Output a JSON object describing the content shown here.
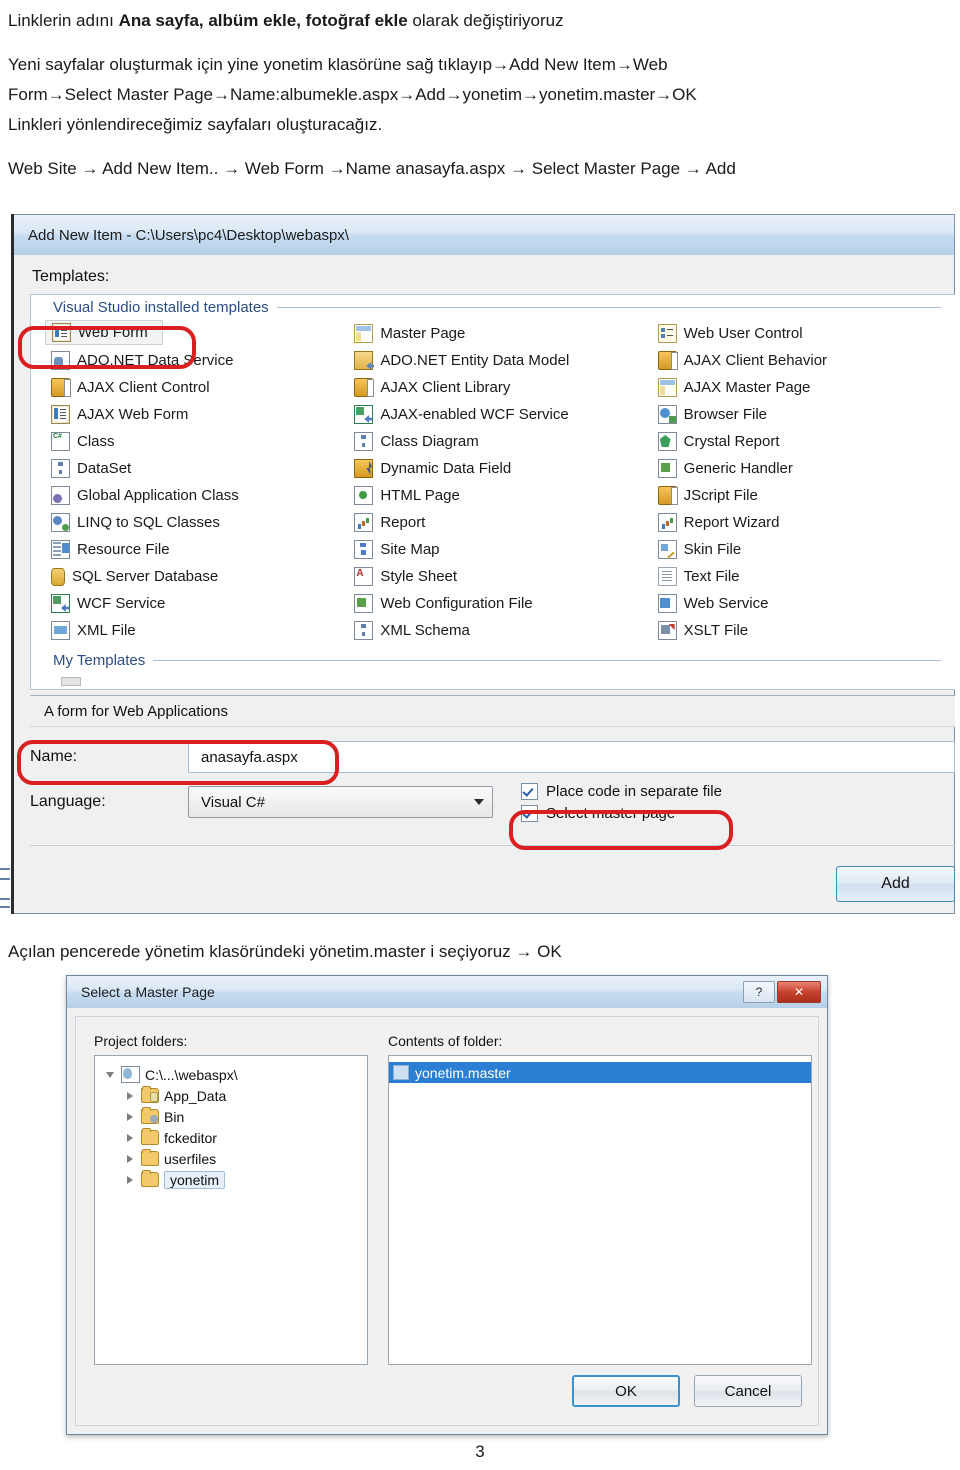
{
  "document": {
    "lines": [
      {
        "id": "l1",
        "segments": [
          {
            "t": "Linklerin adını ",
            "b": false
          },
          {
            "t": "Ana sayfa, albüm ekle, fotoğraf ekle",
            "b": true
          },
          {
            "t": " olarak değiştiriyoruz",
            "b": false
          }
        ]
      },
      {
        "id": "gap1",
        "gap": true
      },
      {
        "id": "l2",
        "segments": [
          {
            "t": "Yeni sayfalar oluşturmak için yine yonetim klasörüne sağ tıklayıp→Add New Item→Web",
            "b": false
          }
        ]
      },
      {
        "id": "l3",
        "segments": [
          {
            "t": "Form→Select Master Page→Name:albumekle.aspx→Add→yonetim→yonetim.master→OK",
            "b": false
          }
        ]
      },
      {
        "id": "l4",
        "segments": [
          {
            "t": "Linkleri yönlendireceğimiz sayfaları oluşturacağız.",
            "b": false
          }
        ]
      },
      {
        "id": "gap2",
        "gap": true
      },
      {
        "id": "l5",
        "segments": [
          {
            "t": "Web Site → Add New Item.. → Web Form →Name  anasayfa.aspx →  Select Master Page → Add",
            "b": false
          }
        ]
      }
    ],
    "middle_caption": "Açılan pencerede yönetim klasöründeki yönetim.master i seçiyoruz → OK",
    "page_number": "3"
  },
  "add_new_item_dialog": {
    "title": "Add New Item - C:\\Users\\pc4\\Desktop\\webaspx\\",
    "templates_label": "Templates:",
    "group_installed": "Visual Studio installed templates",
    "group_my_templates": "My Templates",
    "columns": [
      [
        {
          "label": "Web Form",
          "icon": "form",
          "selected": true
        },
        {
          "label": "ADO.NET Data Service",
          "icon": "ado"
        },
        {
          "label": "AJAX Client Control",
          "icon": "js"
        },
        {
          "label": "AJAX Web Form",
          "icon": "form"
        },
        {
          "label": "Class",
          "icon": "cs"
        },
        {
          "label": "DataSet",
          "icon": "diag"
        },
        {
          "label": "Global Application Class",
          "icon": "gear"
        },
        {
          "label": "LINQ to SQL Classes",
          "icon": "linq"
        },
        {
          "label": "Resource File",
          "icon": "res"
        },
        {
          "label": "SQL Server Database",
          "icon": "db"
        },
        {
          "label": "WCF Service",
          "icon": "wcf"
        },
        {
          "label": "XML File",
          "icon": "xml"
        }
      ],
      [
        {
          "label": "Master Page",
          "icon": "master"
        },
        {
          "label": "ADO.NET Entity Data Model",
          "icon": "adoent"
        },
        {
          "label": "AJAX Client Library",
          "icon": "js"
        },
        {
          "label": "AJAX-enabled WCF Service",
          "icon": "wcf"
        },
        {
          "label": "Class Diagram",
          "icon": "diag"
        },
        {
          "label": "Dynamic Data Field",
          "icon": "dyn"
        },
        {
          "label": "HTML Page",
          "icon": "html"
        },
        {
          "label": "Report",
          "icon": "report"
        },
        {
          "label": "Site Map",
          "icon": "sitemap"
        },
        {
          "label": "Style Sheet",
          "icon": "sheet"
        },
        {
          "label": "Web Configuration File",
          "icon": "handler"
        },
        {
          "label": "XML Schema",
          "icon": "diag"
        }
      ],
      [
        {
          "label": "Web User Control",
          "icon": "wuc"
        },
        {
          "label": "AJAX Client Behavior",
          "icon": "js"
        },
        {
          "label": "AJAX Master Page",
          "icon": "master"
        },
        {
          "label": "Browser File",
          "icon": "browser"
        },
        {
          "label": "Crystal Report",
          "icon": "crystal"
        },
        {
          "label": "Generic Handler",
          "icon": "handler"
        },
        {
          "label": "JScript File",
          "icon": "js"
        },
        {
          "label": "Report Wizard",
          "icon": "report"
        },
        {
          "label": "Skin File",
          "icon": "skin"
        },
        {
          "label": "Text File",
          "icon": "txt"
        },
        {
          "label": "Web Service",
          "icon": "websvc"
        },
        {
          "label": "XSLT File",
          "icon": "xslt"
        }
      ]
    ],
    "description": "A form for Web Applications",
    "name_label": "Name:",
    "name_value": "anasayfa.aspx",
    "language_label": "Language:",
    "language_value": "Visual C#",
    "checkbox_place_code": "Place code in separate file",
    "checkbox_select_master": "Select master page",
    "add_button": "Add"
  },
  "select_master_page_dialog": {
    "title": "Select a Master Page",
    "help_button": "?",
    "close_button": "✕",
    "project_folders_label": "Project folders:",
    "contents_label": "Contents of folder:",
    "tree": [
      {
        "label": "C:\\...\\webaspx\\",
        "depth": 0,
        "icon": "project",
        "expanded": true,
        "selected": false
      },
      {
        "label": "App_Data",
        "depth": 1,
        "icon": "folder-data",
        "expanded": false,
        "selected": false
      },
      {
        "label": "Bin",
        "depth": 1,
        "icon": "folder-bin",
        "expanded": false,
        "selected": false
      },
      {
        "label": "fckeditor",
        "depth": 1,
        "icon": "folder",
        "expanded": false,
        "selected": false
      },
      {
        "label": "userfiles",
        "depth": 1,
        "icon": "folder",
        "expanded": false,
        "selected": false
      },
      {
        "label": "yonetim",
        "depth": 1,
        "icon": "folder",
        "expanded": false,
        "selected": true
      }
    ],
    "contents": [
      {
        "label": "yonetim.master",
        "selected": true
      }
    ],
    "ok_button": "OK",
    "cancel_button": "Cancel"
  },
  "colors": {
    "annotation_red": "#d91f1f",
    "titlebar_blue": "#b6cfe9",
    "selection_blue": "#2a7fd4",
    "group_header_text": "#2a4f86"
  }
}
